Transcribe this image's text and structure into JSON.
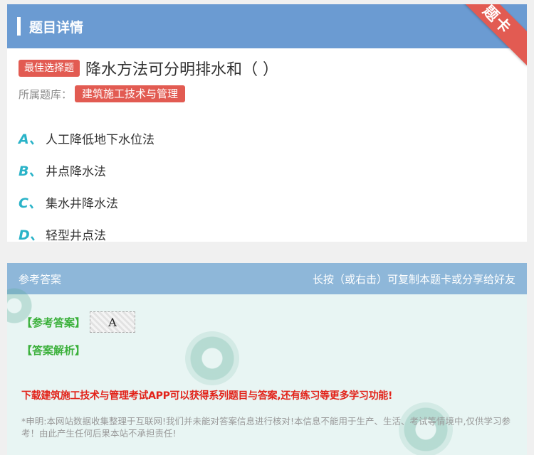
{
  "header": {
    "title": "题目详情",
    "corner_label": "题卡"
  },
  "question": {
    "type_badge": "最佳选择题",
    "text": "降水方法可分明排水和（ ）"
  },
  "bank": {
    "label": "所属题库：",
    "name": "建筑施工技术与管理"
  },
  "options": [
    {
      "letter": "A、",
      "text": "人工降低地下水位法"
    },
    {
      "letter": "B、",
      "text": "井点降水法"
    },
    {
      "letter": "C、",
      "text": "集水井降水法"
    },
    {
      "letter": "D、",
      "text": "轻型井点法"
    }
  ],
  "answer": {
    "header_left": "参考答案",
    "header_right": "长按（或右击）可复制本题卡或分享给好友",
    "ref_label": "【参考答案】",
    "ref_value": "A",
    "analysis_label": "【答案解析】",
    "promo": "下载建筑施工技术与管理考试APP可以获得系列题目与答案,还有练习等更多学习功能!",
    "disclaimer": "*申明:本网站数据收集整理于互联网!我们并未能对答案信息进行核对!本信息不能用于生产、生活、考试等情境中,仅供学习参考！由此产生任何后果本站不承担责任!"
  },
  "colors": {
    "header_blue": "#6b9bd2",
    "accent_red": "#e25b52",
    "option_teal": "#2ab3c8",
    "answer_green": "#3ab03a",
    "promo_red": "#e2231a"
  }
}
